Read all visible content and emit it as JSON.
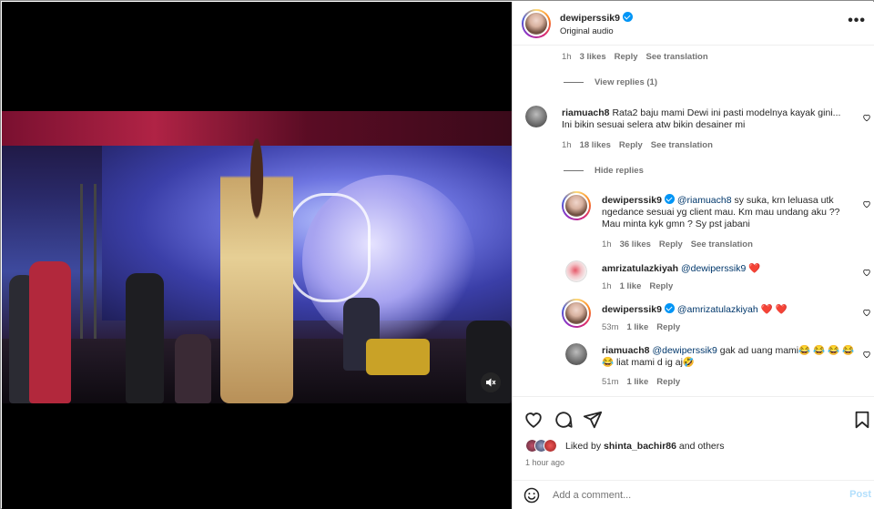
{
  "post": {
    "username": "dewiperssik9",
    "audio": "Original audio"
  },
  "comments": {
    "first_meta": {
      "time": "1h",
      "likes": "3 likes",
      "reply": "Reply",
      "translate": "See translation"
    },
    "view_replies": "View replies (1)",
    "c1": {
      "username": "riamuach8",
      "text": "Rata2 baju mami Dewi ini pasti modelnya kayak gini... Ini bikin sesuai selera atw bikin desainer mi",
      "time": "1h",
      "likes": "18 likes",
      "reply": "Reply",
      "translate": "See translation"
    },
    "hide_replies": "Hide replies",
    "r1": {
      "username": "dewiperssik9",
      "mention": "@riamuach8",
      "text": " sy suka, krn leluasa utk ngedance sesuai yg client mau. Km mau undang aku ?? Mau minta kyk gmn ? Sy pst jabani",
      "time": "1h",
      "likes": "36 likes",
      "reply": "Reply",
      "translate": "See translation"
    },
    "r2": {
      "username": "amrizatulazkiyah",
      "mention": "@dewiperssik9",
      "text": " ❤️",
      "time": "1h",
      "likes": "1 like",
      "reply": "Reply"
    },
    "r3": {
      "username": "dewiperssik9",
      "mention": "@amrizatulazkiyah",
      "text": " ❤️ ❤️",
      "time": "53m",
      "likes": "1 like",
      "reply": "Reply"
    },
    "r4": {
      "username": "riamuach8",
      "mention": "@dewiperssik9",
      "text": " gak ad uang mami😂 😂 😂 😂 😂 liat mami d ig aj🤣",
      "time": "51m",
      "likes": "1 like",
      "reply": "Reply"
    }
  },
  "footer": {
    "liked_prefix": "Liked by ",
    "liked_user": "shinta_bachir86",
    "liked_suffix": " and others",
    "post_time": "1 hour ago",
    "comment_placeholder": "Add a comment...",
    "post_label": "Post"
  },
  "colors": {
    "link": "#00376b",
    "verified": "#0095f6",
    "muted": "#737373",
    "heart_red": "#ed4956"
  }
}
